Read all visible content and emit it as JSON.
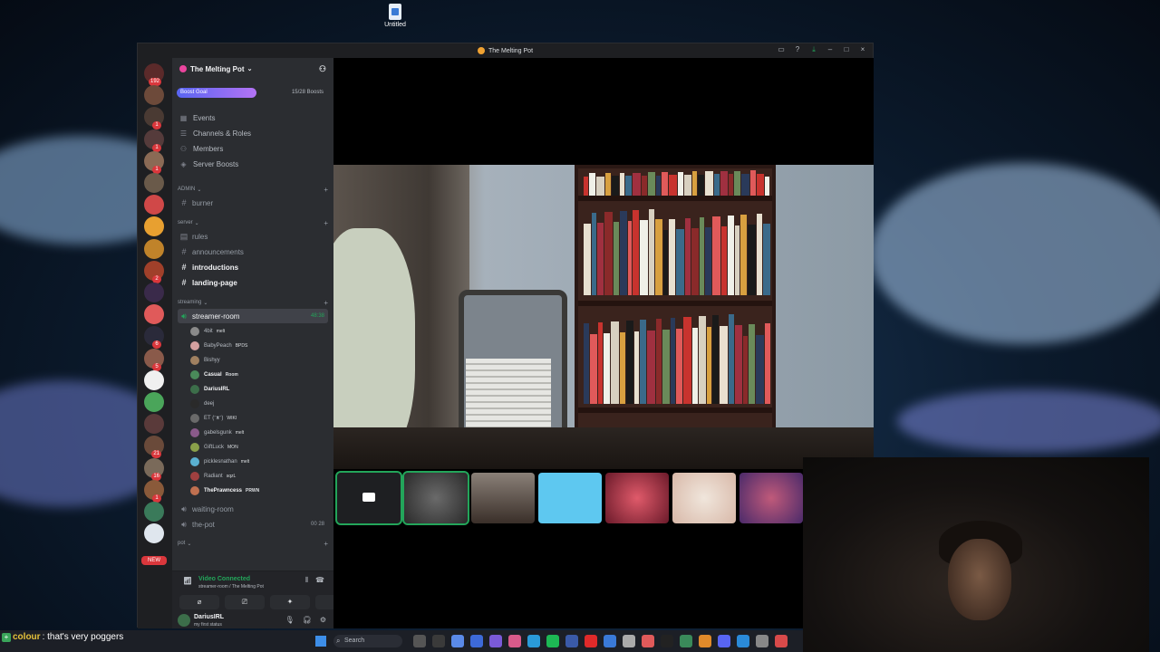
{
  "desktop": {
    "icon_label": "Untitled"
  },
  "window": {
    "title": "The Melting Pot"
  },
  "rail": {
    "servers": [
      {
        "badge": "192",
        "color": "#5b2a2a"
      },
      {
        "badge": "",
        "color": "#6d4a3a"
      },
      {
        "badge": "1",
        "color": "#4a3a33"
      },
      {
        "badge": "1",
        "color": "#553b3b"
      },
      {
        "badge": "1",
        "color": "#8a6a55"
      },
      {
        "badge": "",
        "color": "#6a5a4a"
      },
      {
        "badge": "",
        "color": "#d04848"
      },
      {
        "badge": "",
        "color": "#e8a030"
      },
      {
        "badge": "",
        "color": "#c0832a"
      },
      {
        "badge": "2",
        "color": "#a0402a"
      },
      {
        "badge": "",
        "color": "#3a2a4a"
      },
      {
        "badge": "",
        "color": "#e05a5a"
      },
      {
        "badge": "6",
        "color": "#2a2a3a"
      },
      {
        "badge": "5",
        "color": "#8a5a4a"
      },
      {
        "badge": "",
        "color": "#f0f0f0"
      },
      {
        "badge": "",
        "color": "#4aa55a"
      },
      {
        "badge": "",
        "color": "#5a3a3a"
      },
      {
        "badge": "21",
        "color": "#6a4a3a"
      },
      {
        "badge": "16",
        "color": "#7a6a5a"
      },
      {
        "badge": "1",
        "color": "#8a5a3a"
      },
      {
        "badge": "",
        "color": "#3a7a5a"
      },
      {
        "badge": "",
        "color": "#dfe6ee"
      }
    ],
    "new_label": "NEW"
  },
  "sidebar": {
    "server_name": "The Melting Pot",
    "boost_label": "Boost Goal",
    "boost_count": "15/28 Boosts",
    "menu": [
      "Events",
      "Channels & Roles",
      "Members",
      "Server Boosts"
    ],
    "categories": {
      "admin": "ADMIN",
      "server": "server",
      "streaming": "streaming",
      "pot": "pot"
    },
    "channels": {
      "burner": "burner",
      "rules": "rules",
      "announcements": "announcements",
      "introductions": "introductions",
      "landing_page": "landing-page",
      "streamer_room": "streamer-room",
      "streamer_room_time": "48:38",
      "waiting_room": "waiting-room",
      "the_pot": "the-pot",
      "the_pot_count": "00 28"
    },
    "voice_users": [
      {
        "name": "4bit",
        "tag": "melt",
        "color": "#8a8a8a",
        "bold": false
      },
      {
        "name": "BabyPeach",
        "tag": "BPDS",
        "color": "#d4a0a0",
        "bold": false
      },
      {
        "name": "Bishyy",
        "tag": "",
        "color": "#a08060",
        "bold": false
      },
      {
        "name": "Casual",
        "tag": "Room",
        "color": "#4a8a5a",
        "bold": true
      },
      {
        "name": "DariusIRL",
        "tag": "",
        "color": "#3c6e4a",
        "bold": true
      },
      {
        "name": "deej",
        "tag": "",
        "color": "#2a2a2a",
        "bold": false
      },
      {
        "name": "ET (ᵔᴥᵔ)",
        "tag": "WIKI",
        "color": "#6a6a6a",
        "bold": false
      },
      {
        "name": "gabelsgunk",
        "tag": "melt",
        "color": "#8a5a8a",
        "bold": false
      },
      {
        "name": "GiftLuck",
        "tag": "MON",
        "color": "#8aa04a",
        "bold": false
      },
      {
        "name": "picklesnathan",
        "tag": "melt",
        "color": "#5ab0d0",
        "bold": false
      },
      {
        "name": "Radiant",
        "tag": "sqzL",
        "color": "#a04040",
        "bold": false
      },
      {
        "name": "ThePrawncess",
        "tag": "PRWN",
        "color": "#c07050",
        "bold": true
      }
    ],
    "voice_panel": {
      "status": "Video Connected",
      "location": "streamer-room / The Melting Pot"
    },
    "user": {
      "name": "DariusIRL",
      "status": "my first status"
    }
  },
  "chat": {
    "user": "colour",
    "message": ": that's very poggers"
  },
  "taskbar": {
    "search_placeholder": "Search"
  }
}
